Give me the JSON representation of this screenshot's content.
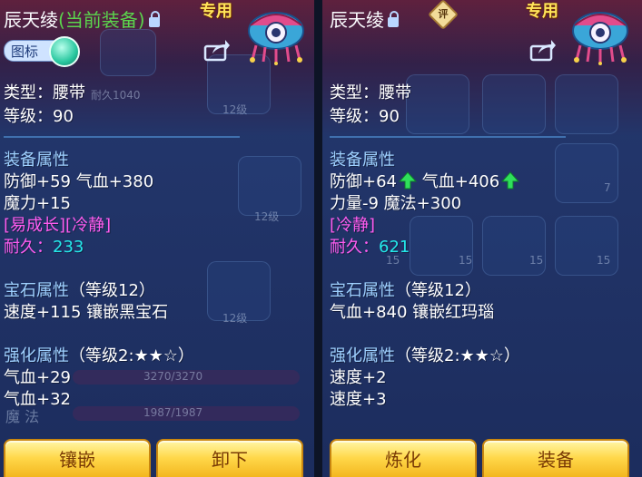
{
  "left": {
    "title_name": "辰天绫",
    "title_current": "(当前装备)",
    "exclusive": "专用",
    "icon_toggle_label": "图标",
    "type_line": "类型：腰带",
    "level_line": "等级：90",
    "attr_header": "装备属性",
    "attr_line1": "防御+59 气血+380",
    "attr_line2": "魔力+15",
    "special": "[易成长][冷静]",
    "durability_label": "耐久：",
    "durability_value": "233",
    "gem_header": "宝石属性",
    "gem_level": "（等级12）",
    "gem_line": "速度+115 镶嵌黑宝石",
    "enh_header": "强化属性",
    "enh_level": "（等级2:★★☆）",
    "enh_line1": "气血+29",
    "enh_line2": "气血+32",
    "btn_inlay": "镶嵌",
    "btn_remove": "卸下",
    "bg_texts": [
      "耐久1040",
      "12级",
      "12级",
      "12级",
      "3270/3270",
      "1987/1987",
      "魔 法"
    ]
  },
  "right": {
    "title_name": "辰天绫",
    "eval_badge": "评",
    "exclusive": "专用",
    "type_line": "类型：腰带",
    "level_line": "等级：90",
    "attr_header": "装备属性",
    "attr_line1_a": "防御+64",
    "attr_line1_b": "气血+406",
    "attr_line2": "力量-9 魔法+300",
    "special": "[冷静]",
    "durability_label": "耐久：",
    "durability_value": "621",
    "gem_header": "宝石属性",
    "gem_level": "（等级12）",
    "gem_line": "气血+840 镶嵌红玛瑙",
    "enh_header": "强化属性",
    "enh_level": "（等级2:★★☆）",
    "enh_line1": "速度+2",
    "enh_line2": "速度+3",
    "btn_refine": "炼化",
    "btn_equip": "装备",
    "bg_texts": [
      "7",
      "15",
      "15",
      "15",
      "15"
    ]
  },
  "colors": {
    "header": "#9ed0ff",
    "special": "#ff5cf0",
    "durability": "#24e8ea",
    "button": "#ffd84a",
    "up_arrow": "#2fe05b"
  },
  "icons": [
    "lock-icon",
    "share-icon",
    "mascot-icon",
    "up-arrow-icon",
    "evaluate-badge-icon"
  ]
}
